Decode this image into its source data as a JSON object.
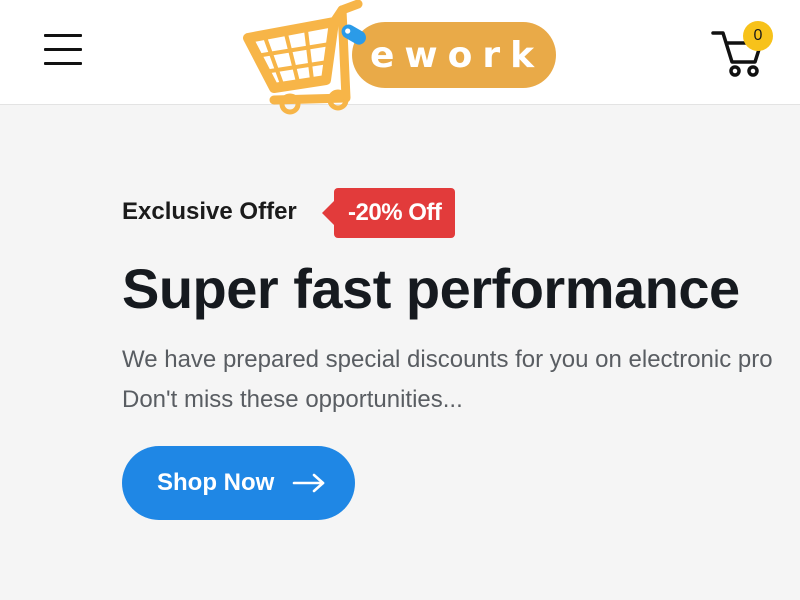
{
  "header": {
    "menu_icon": "hamburger-menu-icon",
    "logo": {
      "text": "ework",
      "icon": "shopping-cart-logo-icon",
      "colors": {
        "pill": "#e9aa48",
        "cart": "#f7b548",
        "tag": "#2b9be8"
      }
    },
    "cart": {
      "icon": "shopping-cart-icon",
      "count": "0",
      "badge_color": "#f7c21a"
    }
  },
  "hero": {
    "offer_label": "Exclusive Offer",
    "offer_tag": "-20% Off",
    "title": "Super fast performance",
    "description_line1": "We have prepared special discounts for you on electronic pro",
    "description_line2": "Don't miss these opportunities...",
    "button_label": "Shop Now",
    "button_icon": "arrow-right-icon"
  },
  "colors": {
    "accent": "#1f87e5",
    "tag_red": "#e23b3b",
    "title": "#161a1f",
    "text": "#595d62",
    "background": "#f5f5f5"
  }
}
